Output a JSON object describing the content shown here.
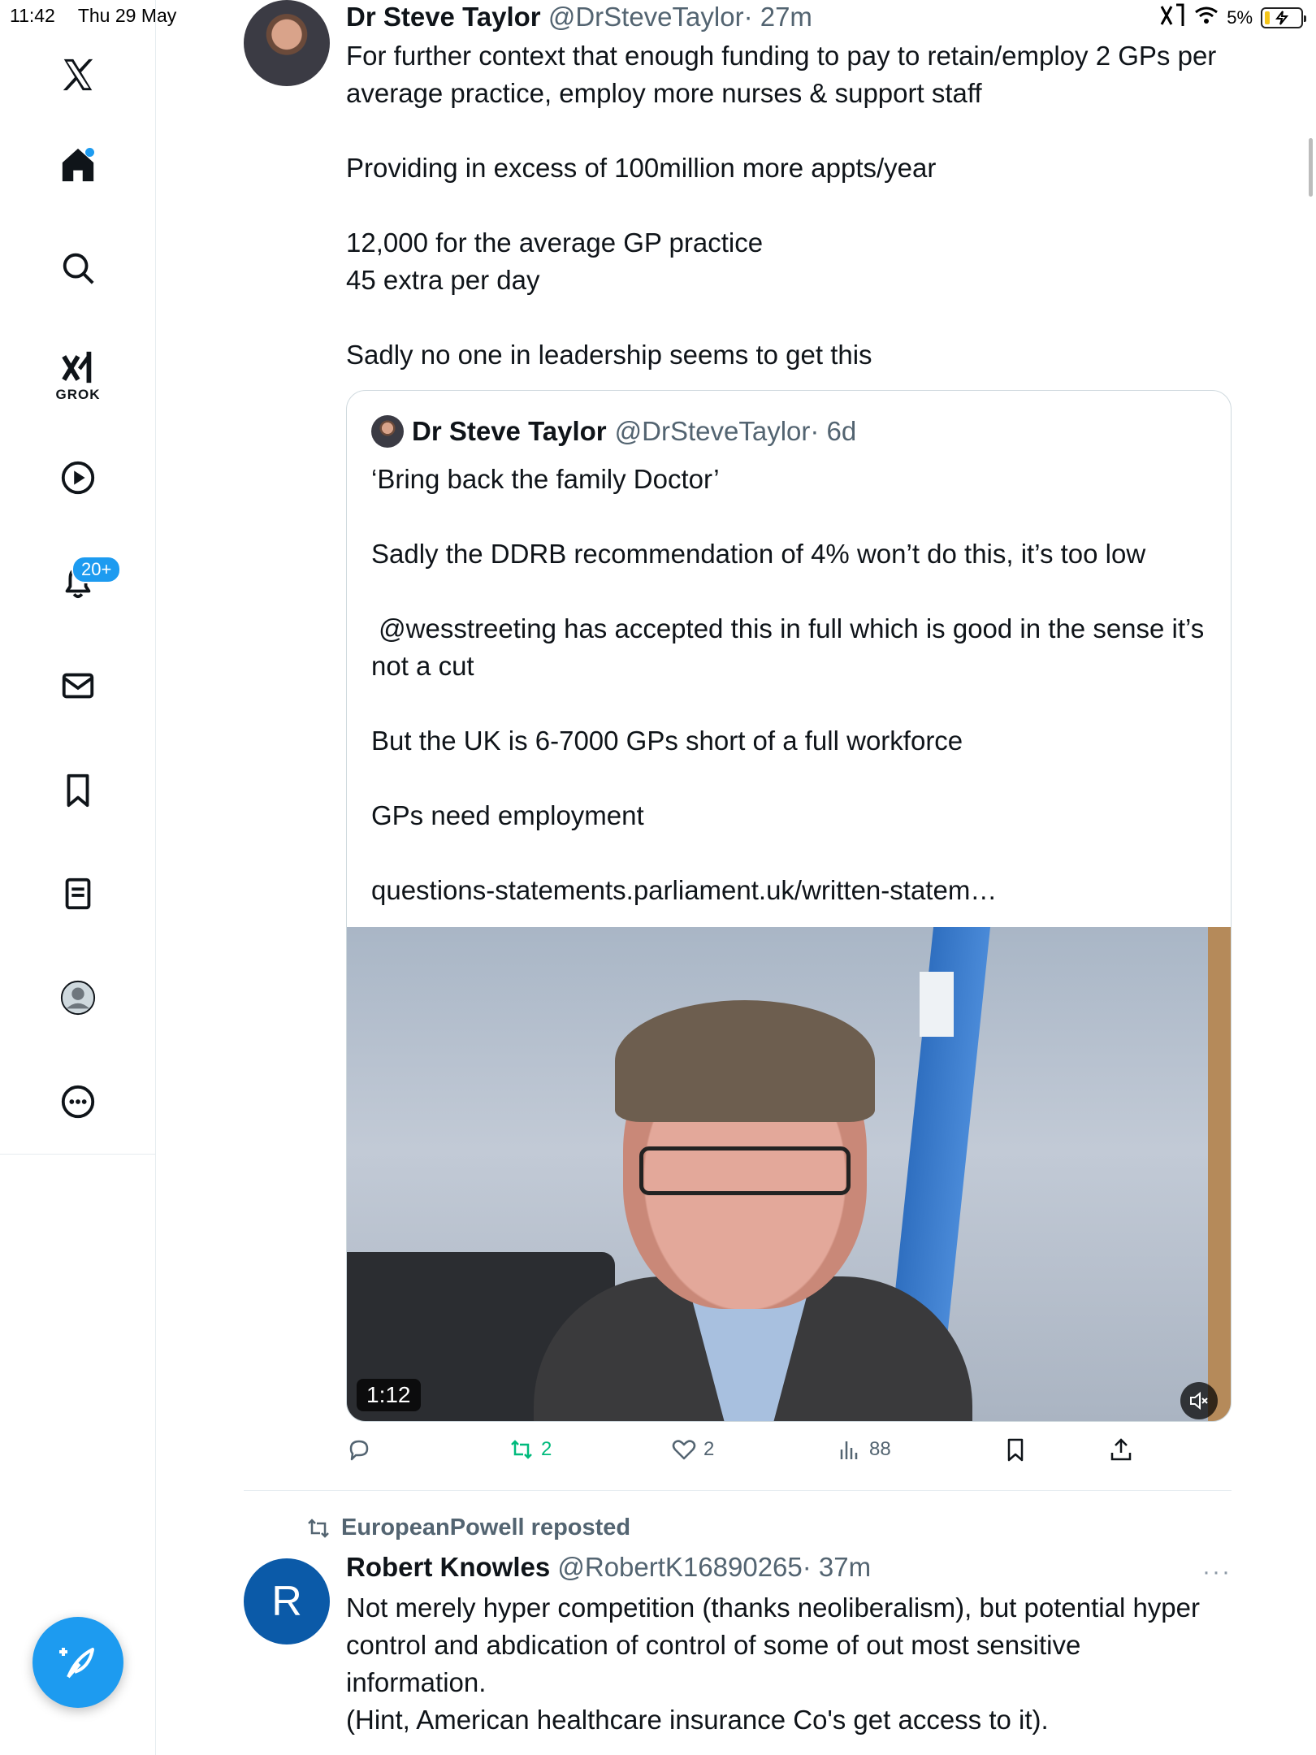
{
  "status": {
    "time": "11:42",
    "date": "Thu 29 May",
    "battery": "5%"
  },
  "sidebar": {
    "grok_label": "GROK",
    "notifications_badge": "20+",
    "items": [
      "home",
      "search",
      "grok",
      "video",
      "notifications",
      "messages",
      "bookmarks",
      "lists",
      "profile",
      "more"
    ]
  },
  "tweet": {
    "name": "Dr Steve Taylor",
    "handle": "@DrSteveTaylor",
    "time": "· 27m",
    "text": "For further context that enough funding to pay to retain/employ 2 GPs per average practice, employ more nurses & support staff\n\nProviding in excess of 100million more appts/year\n\n12,000 for the average GP practice\n45 extra per day\n\nSadly no one in leadership seems to get this",
    "quote": {
      "name": "Dr Steve Taylor",
      "handle": "@DrSteveTaylor",
      "time": "· 6d",
      "text": "‘Bring back the family Doctor’\n\nSadly the DDRB recommendation of 4% won’t do this, it’s too low\n\n @wesstreeting has accepted this in full which is good in the sense it’s not a cut\n\nBut the UK is 6-7000 GPs short of a full workforce\n\nGPs need employment\n\nquestions-statements.parliament.uk/written-statem…",
      "video_duration": "1:12"
    },
    "actions": {
      "reposts": "2",
      "likes": "2",
      "views": "88"
    }
  },
  "tweet2": {
    "reposted_by": "EuropeanPowell reposted",
    "avatar_letter": "R",
    "name": "Robert Knowles",
    "handle": "@RobertK16890265",
    "time": "· 37m",
    "more": "···",
    "text": "Not merely hyper competition (thanks neoliberalism), but potential hyper control and abdication of control of some of out most sensitive information.\n(Hint, American healthcare insurance Co's get access to it)."
  },
  "colors": {
    "accent": "#1d9bf0",
    "retweet_green": "#00ba7c",
    "muted": "#536471",
    "border": "#cfd9de"
  }
}
